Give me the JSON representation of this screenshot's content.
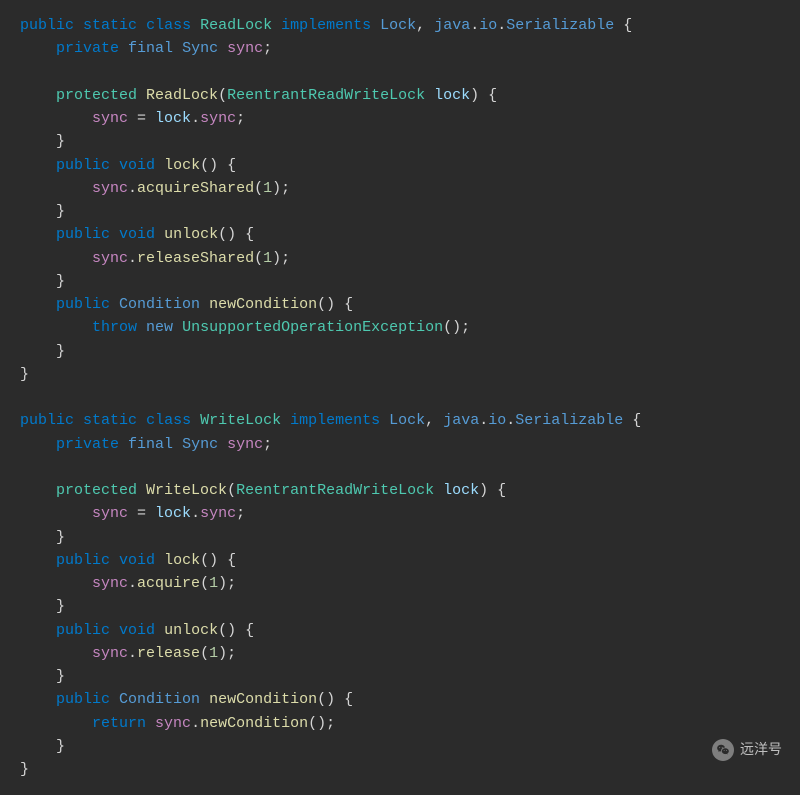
{
  "watermark": {
    "text": "远洋号"
  },
  "code": {
    "lines": [
      [
        [
          "kw-dark",
          "public"
        ],
        [
          "plain",
          " "
        ],
        [
          "kw-dark",
          "static"
        ],
        [
          "plain",
          " "
        ],
        [
          "kw-dark",
          "class"
        ],
        [
          "plain",
          " "
        ],
        [
          "cls-name",
          "ReadLock"
        ],
        [
          "plain",
          " "
        ],
        [
          "kw-dark",
          "implements"
        ],
        [
          "plain",
          " "
        ],
        [
          "kw-light",
          "Lock"
        ],
        [
          "plain",
          ", "
        ],
        [
          "kw-light",
          "java"
        ],
        [
          "plain",
          "."
        ],
        [
          "kw-light",
          "io"
        ],
        [
          "plain",
          "."
        ],
        [
          "kw-light",
          "Serializable"
        ],
        [
          "plain",
          " {"
        ]
      ],
      [
        [
          "plain",
          "    "
        ],
        [
          "kw-dark",
          "private"
        ],
        [
          "plain",
          " "
        ],
        [
          "kw-light",
          "final"
        ],
        [
          "plain",
          " "
        ],
        [
          "kw-light",
          "Sync"
        ],
        [
          "plain",
          " "
        ],
        [
          "field-mag",
          "sync"
        ],
        [
          "plain",
          ";"
        ]
      ],
      [
        [
          "plain",
          ""
        ]
      ],
      [
        [
          "plain",
          "    "
        ],
        [
          "kw-green",
          "protected"
        ],
        [
          "plain",
          " "
        ],
        [
          "fn-yellow",
          "ReadLock"
        ],
        [
          "plain",
          "("
        ],
        [
          "cls-name",
          "ReentrantReadWriteLock"
        ],
        [
          "plain",
          " "
        ],
        [
          "var-blue",
          "lock"
        ],
        [
          "plain",
          ") {"
        ]
      ],
      [
        [
          "plain",
          "        "
        ],
        [
          "field-mag",
          "sync"
        ],
        [
          "plain",
          " = "
        ],
        [
          "var-blue",
          "lock"
        ],
        [
          "plain",
          "."
        ],
        [
          "field-mag",
          "sync"
        ],
        [
          "plain",
          ";"
        ]
      ],
      [
        [
          "plain",
          "    }"
        ]
      ],
      [
        [
          "plain",
          "    "
        ],
        [
          "kw-dark",
          "public"
        ],
        [
          "plain",
          " "
        ],
        [
          "kw-dark",
          "void"
        ],
        [
          "plain",
          " "
        ],
        [
          "fn-yellow",
          "lock"
        ],
        [
          "plain",
          "() {"
        ]
      ],
      [
        [
          "plain",
          "        "
        ],
        [
          "field-mag",
          "sync"
        ],
        [
          "plain",
          "."
        ],
        [
          "fn-yellow",
          "acquireShared"
        ],
        [
          "plain",
          "("
        ],
        [
          "num",
          "1"
        ],
        [
          "plain",
          ");"
        ]
      ],
      [
        [
          "plain",
          "    }"
        ]
      ],
      [
        [
          "plain",
          "    "
        ],
        [
          "kw-dark",
          "public"
        ],
        [
          "plain",
          " "
        ],
        [
          "kw-dark",
          "void"
        ],
        [
          "plain",
          " "
        ],
        [
          "fn-yellow",
          "unlock"
        ],
        [
          "plain",
          "() {"
        ]
      ],
      [
        [
          "plain",
          "        "
        ],
        [
          "field-mag",
          "sync"
        ],
        [
          "plain",
          "."
        ],
        [
          "fn-yellow",
          "releaseShared"
        ],
        [
          "plain",
          "("
        ],
        [
          "num",
          "1"
        ],
        [
          "plain",
          ");"
        ]
      ],
      [
        [
          "plain",
          "    }"
        ]
      ],
      [
        [
          "plain",
          "    "
        ],
        [
          "kw-dark",
          "public"
        ],
        [
          "plain",
          " "
        ],
        [
          "kw-light",
          "Condition"
        ],
        [
          "plain",
          " "
        ],
        [
          "fn-yellow",
          "newCondition"
        ],
        [
          "plain",
          "() {"
        ]
      ],
      [
        [
          "plain",
          "        "
        ],
        [
          "kw-dark",
          "throw"
        ],
        [
          "plain",
          " "
        ],
        [
          "new-kw",
          "new"
        ],
        [
          "plain",
          " "
        ],
        [
          "cls-name",
          "UnsupportedOperationException"
        ],
        [
          "plain",
          "();"
        ]
      ],
      [
        [
          "plain",
          "    }"
        ]
      ],
      [
        [
          "plain",
          "}"
        ]
      ],
      [
        [
          "plain",
          ""
        ]
      ],
      [
        [
          "kw-dark",
          "public"
        ],
        [
          "plain",
          " "
        ],
        [
          "kw-dark",
          "static"
        ],
        [
          "plain",
          " "
        ],
        [
          "kw-dark",
          "class"
        ],
        [
          "plain",
          " "
        ],
        [
          "cls-name",
          "WriteLock"
        ],
        [
          "plain",
          " "
        ],
        [
          "kw-dark",
          "implements"
        ],
        [
          "plain",
          " "
        ],
        [
          "kw-light",
          "Lock"
        ],
        [
          "plain",
          ", "
        ],
        [
          "kw-light",
          "java"
        ],
        [
          "plain",
          "."
        ],
        [
          "kw-light",
          "io"
        ],
        [
          "plain",
          "."
        ],
        [
          "kw-light",
          "Serializable"
        ],
        [
          "plain",
          " {"
        ]
      ],
      [
        [
          "plain",
          "    "
        ],
        [
          "kw-dark",
          "private"
        ],
        [
          "plain",
          " "
        ],
        [
          "kw-light",
          "final"
        ],
        [
          "plain",
          " "
        ],
        [
          "kw-light",
          "Sync"
        ],
        [
          "plain",
          " "
        ],
        [
          "field-mag",
          "sync"
        ],
        [
          "plain",
          ";"
        ]
      ],
      [
        [
          "plain",
          ""
        ]
      ],
      [
        [
          "plain",
          "    "
        ],
        [
          "kw-green",
          "protected"
        ],
        [
          "plain",
          " "
        ],
        [
          "fn-yellow",
          "WriteLock"
        ],
        [
          "plain",
          "("
        ],
        [
          "cls-name",
          "ReentrantReadWriteLock"
        ],
        [
          "plain",
          " "
        ],
        [
          "var-blue",
          "lock"
        ],
        [
          "plain",
          ") {"
        ]
      ],
      [
        [
          "plain",
          "        "
        ],
        [
          "field-mag",
          "sync"
        ],
        [
          "plain",
          " = "
        ],
        [
          "var-blue",
          "lock"
        ],
        [
          "plain",
          "."
        ],
        [
          "field-mag",
          "sync"
        ],
        [
          "plain",
          ";"
        ]
      ],
      [
        [
          "plain",
          "    }"
        ]
      ],
      [
        [
          "plain",
          "    "
        ],
        [
          "kw-dark",
          "public"
        ],
        [
          "plain",
          " "
        ],
        [
          "kw-dark",
          "void"
        ],
        [
          "plain",
          " "
        ],
        [
          "fn-yellow",
          "lock"
        ],
        [
          "plain",
          "() {"
        ]
      ],
      [
        [
          "plain",
          "        "
        ],
        [
          "field-mag",
          "sync"
        ],
        [
          "plain",
          "."
        ],
        [
          "fn-yellow",
          "acquire"
        ],
        [
          "plain",
          "("
        ],
        [
          "num",
          "1"
        ],
        [
          "plain",
          ");"
        ]
      ],
      [
        [
          "plain",
          "    }"
        ]
      ],
      [
        [
          "plain",
          "    "
        ],
        [
          "kw-dark",
          "public"
        ],
        [
          "plain",
          " "
        ],
        [
          "kw-dark",
          "void"
        ],
        [
          "plain",
          " "
        ],
        [
          "fn-yellow",
          "unlock"
        ],
        [
          "plain",
          "() {"
        ]
      ],
      [
        [
          "plain",
          "        "
        ],
        [
          "field-mag",
          "sync"
        ],
        [
          "plain",
          "."
        ],
        [
          "fn-yellow",
          "release"
        ],
        [
          "plain",
          "("
        ],
        [
          "num",
          "1"
        ],
        [
          "plain",
          ");"
        ]
      ],
      [
        [
          "plain",
          "    }"
        ]
      ],
      [
        [
          "plain",
          "    "
        ],
        [
          "kw-dark",
          "public"
        ],
        [
          "plain",
          " "
        ],
        [
          "kw-light",
          "Condition"
        ],
        [
          "plain",
          " "
        ],
        [
          "fn-yellow",
          "newCondition"
        ],
        [
          "plain",
          "() {"
        ]
      ],
      [
        [
          "plain",
          "        "
        ],
        [
          "kw-dark",
          "return"
        ],
        [
          "plain",
          " "
        ],
        [
          "field-mag",
          "sync"
        ],
        [
          "plain",
          "."
        ],
        [
          "fn-yellow",
          "newCondition"
        ],
        [
          "plain",
          "();"
        ]
      ],
      [
        [
          "plain",
          "    }"
        ]
      ],
      [
        [
          "plain",
          "}"
        ]
      ]
    ]
  }
}
